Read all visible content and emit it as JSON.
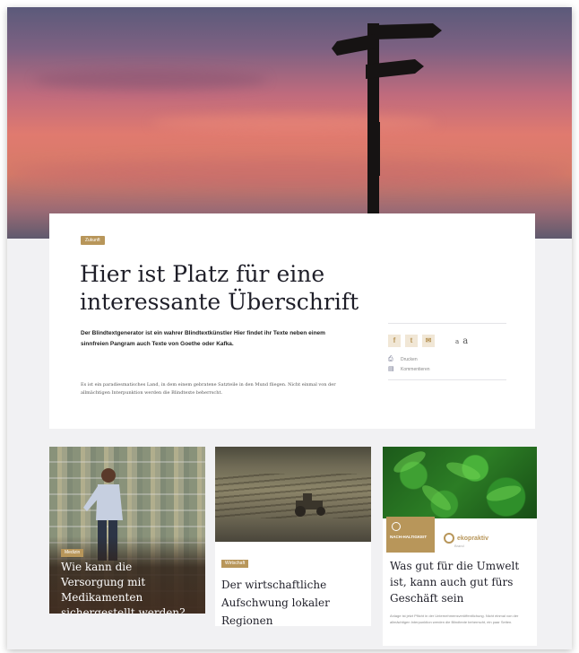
{
  "article": {
    "category": "Zukunft",
    "headline": "Hier ist Platz für eine interessante Überschrift",
    "lead": "Der Blindtextgenerator ist ein wahrer Blindtextkünstler Hier findet ihr Texte neben einem sinnfreien Pangram auch Texte von Goethe oder Kafka.",
    "body": "Es ist ein paradiesmatisches Land, in dem einem gebratene Satzteile in den Mund fliegen. Nicht einmal von der allmächtigen Interpunktion werden die Blindtexte beherrscht."
  },
  "share": {
    "facebook_icon": "f",
    "twitter_icon": "t",
    "mail_icon": "✉",
    "font_small": "a",
    "font_large": "a",
    "print_label": "Drucken",
    "print_icon": "printer-icon",
    "comment_label": "Kommentieren",
    "comment_icon": "comment-icon"
  },
  "cards": [
    {
      "category": "Medizin",
      "title": "Wie kann die Versorgung mit Medikamenten sichergestellt werden?"
    },
    {
      "category": "Wirtschaft",
      "title": "Der wirtschaftliche Aufschwung lokaler Regionen"
    },
    {
      "sponsor_label": "NACH-HALTIGKEIT",
      "brand_name": "ekopraktiv",
      "brand_sub": "Brand",
      "title": "Was gut für die Umwelt ist, kann auch gut fürs Geschäft sein",
      "excerpt": "Anlage ist jetzt Pflicht in der Unternehmensveröffentlichung. Nicht einmal von der allmächtigen Interpunktion werden die Blindtexte beherrscht, ein paar Seiten."
    }
  ],
  "colors": {
    "accent": "#b8965a",
    "headline": "#1e1e28",
    "background": "#f1f1f3"
  }
}
